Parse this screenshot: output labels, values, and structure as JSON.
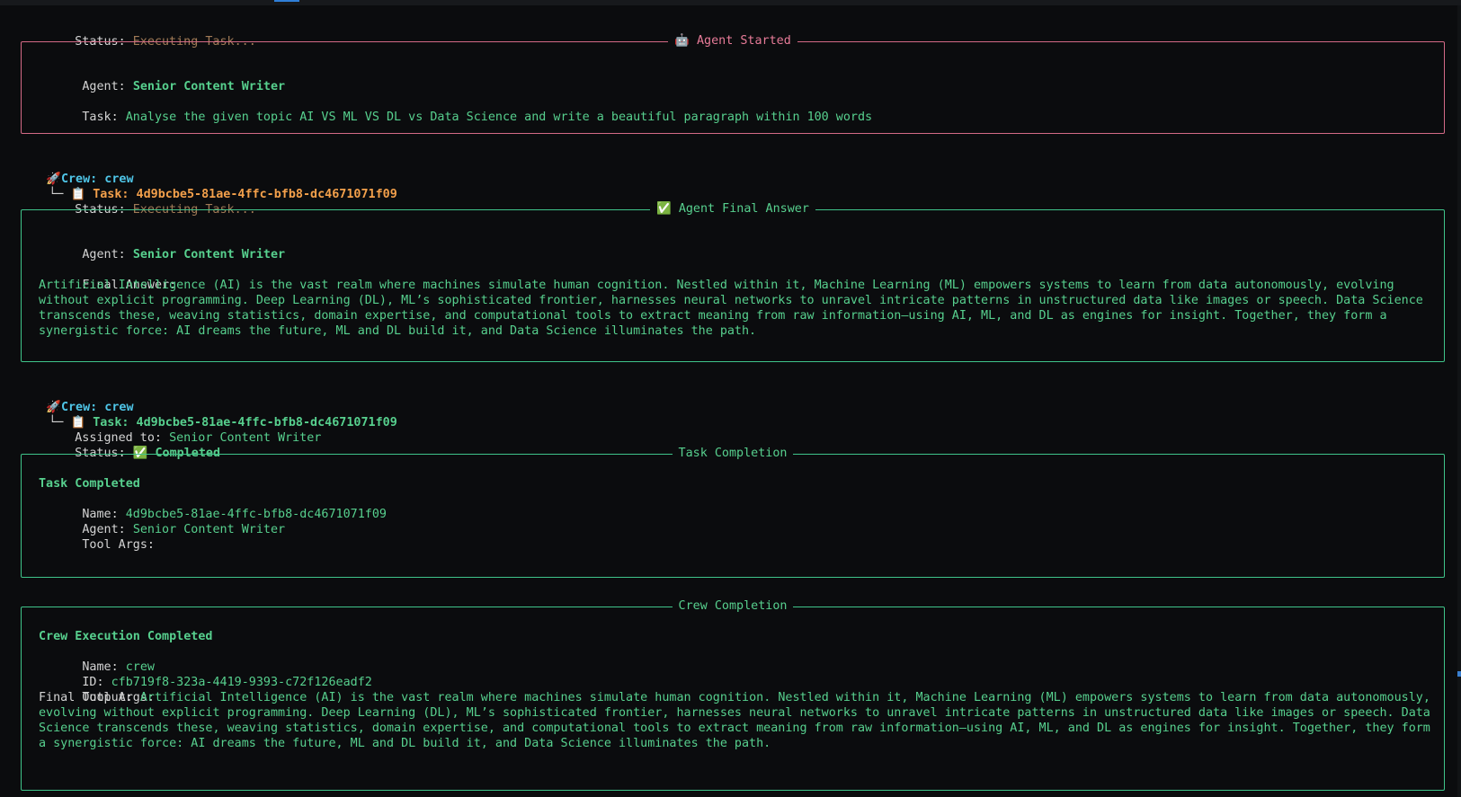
{
  "header": {
    "status_label": "Status:",
    "status_value": "Executing Task..."
  },
  "agent_started": {
    "title_icon": "🤖",
    "title": "Agent Started",
    "agent_label": "Agent:",
    "agent_value": "Senior Content Writer",
    "task_label": "Task:",
    "task_value": "Analyse the given topic AI VS ML VS DL vs Data Science and write a beautiful paragraph within 100 words"
  },
  "tree1": {
    "rocket": "🚀",
    "crew_label": "Crew: crew",
    "clipboard": "📋",
    "task_label": "Task: 4d9bcbe5-81ae-4ffc-bfb8-dc4671071f09",
    "status_label": "Status:",
    "status_value": "Executing Task..."
  },
  "final_answer": {
    "title_icon": "✅",
    "title": "Agent Final Answer",
    "agent_label": "Agent:",
    "agent_value": "Senior Content Writer",
    "answer_label": "Final Answer:",
    "answer_text": "Artificial Intelligence (AI) is the vast realm where machines simulate human cognition. Nestled within it, Machine Learning (ML) empowers systems to learn from data autonomously, evolving without explicit programming. Deep Learning (DL), ML’s sophisticated frontier, harnesses neural networks to unravel intricate patterns in unstructured data like images or speech. Data Science transcends these, weaving statistics, domain expertise, and computational tools to extract meaning from raw information—using AI, ML, and DL as engines for insight. Together, they form a synergistic force: AI dreams the future, ML and DL build it, and Data Science illuminates the path."
  },
  "tree2": {
    "rocket": "🚀",
    "crew_label": "Crew: crew",
    "clipboard": "📋",
    "task_label": "Task: 4d9bcbe5-81ae-4ffc-bfb8-dc4671071f09",
    "assigned_label": "Assigned to:",
    "assigned_value": "Senior Content Writer",
    "status_label": "Status:",
    "status_icon": "✅",
    "status_value": "Completed"
  },
  "task_completion": {
    "title": "Task Completion",
    "heading": "Task Completed",
    "name_label": "Name:",
    "name_value": "4d9bcbe5-81ae-4ffc-bfb8-dc4671071f09",
    "agent_label": "Agent:",
    "agent_value": "Senior Content Writer",
    "tool_args_label": "Tool Args:"
  },
  "crew_completion": {
    "title": "Crew Completion",
    "heading": "Crew Execution Completed",
    "name_label": "Name:",
    "name_value": "crew",
    "id_label": "ID:",
    "id_value": "cfb719f8-323a-4419-9393-c72f126eadf2",
    "tool_args_label": "Tool Args:",
    "output_label": "Final Output:",
    "output_text": "Artificial Intelligence (AI) is the vast realm where machines simulate human cognition. Nestled within it, Machine Learning (ML) empowers systems to learn from data autonomously, evolving without explicit programming. Deep Learning (DL), ML’s sophisticated frontier, harnesses neural networks to unravel intricate patterns in unstructured data like images or speech. Data Science transcends these, weaving statistics, domain expertise, and computational tools to extract meaning from raw information—using AI, ML, and DL as engines for insight. Together, they form a synergistic force: AI dreams the future, ML and DL build it, and Data Science illuminates the path."
  },
  "colors": {
    "background": "#0b0c0e",
    "accent_green": "#57d08e",
    "accent_pink": "#e77b98",
    "accent_cyan": "#4fc6e8",
    "accent_orange": "#f3a04b",
    "status_muted": "#a07a56"
  }
}
